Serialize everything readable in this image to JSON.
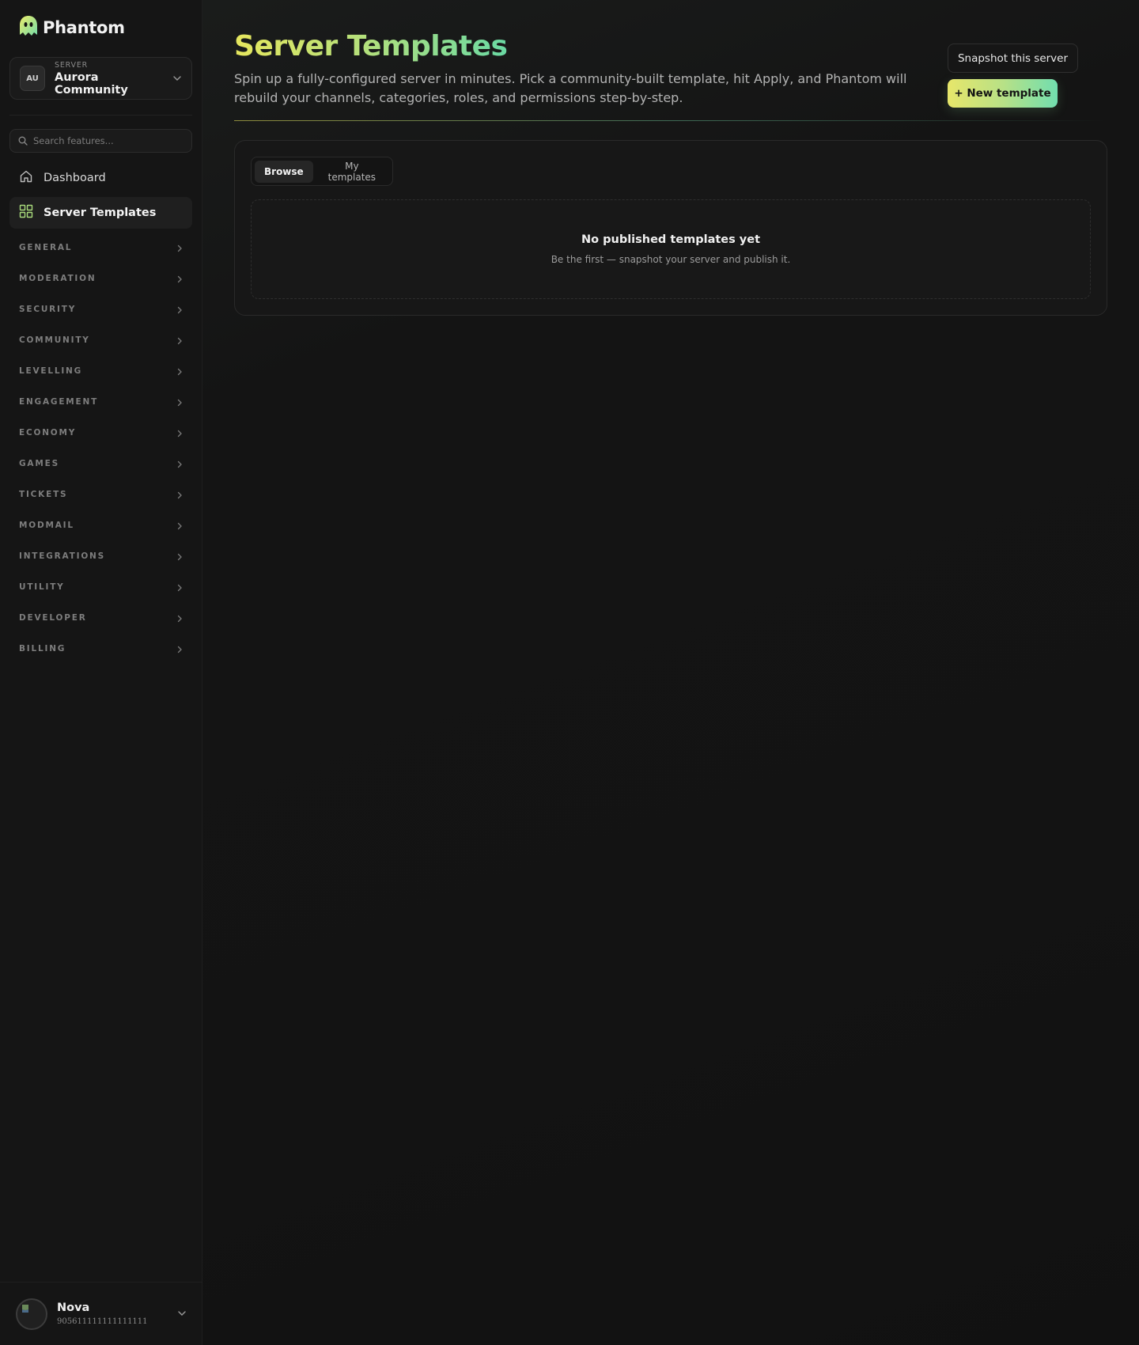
{
  "brand": {
    "name": "Phantom",
    "logo_icon": "ghost-icon"
  },
  "server_switcher": {
    "label": "SERVER",
    "initials": "AU",
    "name": "Aurora Community"
  },
  "search": {
    "placeholder": "Search features..."
  },
  "nav": [
    {
      "label": "Dashboard",
      "icon": "home-icon",
      "active": false
    },
    {
      "label": "Server Templates",
      "icon": "grid-icon",
      "active": true
    }
  ],
  "sections": [
    "GENERAL",
    "MODERATION",
    "SECURITY",
    "COMMUNITY",
    "LEVELLING",
    "ENGAGEMENT",
    "ECONOMY",
    "GAMES",
    "TICKETS",
    "MODMAIL",
    "INTEGRATIONS",
    "UTILITY",
    "DEVELOPER",
    "BILLING"
  ],
  "user": {
    "name": "Nova",
    "id": "905611111111111111"
  },
  "page": {
    "title": "Server Templates",
    "description": "Spin up a fully-configured server in minutes. Pick a community-built template, hit Apply, and Phantom will rebuild your channels, categories, roles, and permissions step-by-step.",
    "actions": {
      "snapshot": "Snapshot this server",
      "new_template": "+ New template"
    }
  },
  "tabs": [
    {
      "label": "Browse",
      "active": true
    },
    {
      "label": "My templates",
      "active": false
    }
  ],
  "empty_state": {
    "title": "No published templates yet",
    "subtitle": "Be the first — snapshot your server and publish it."
  },
  "colors": {
    "accent_start": "#e6e75e",
    "accent_end": "#6ad9a3",
    "background": "#131313",
    "sidebar": "#151515"
  }
}
